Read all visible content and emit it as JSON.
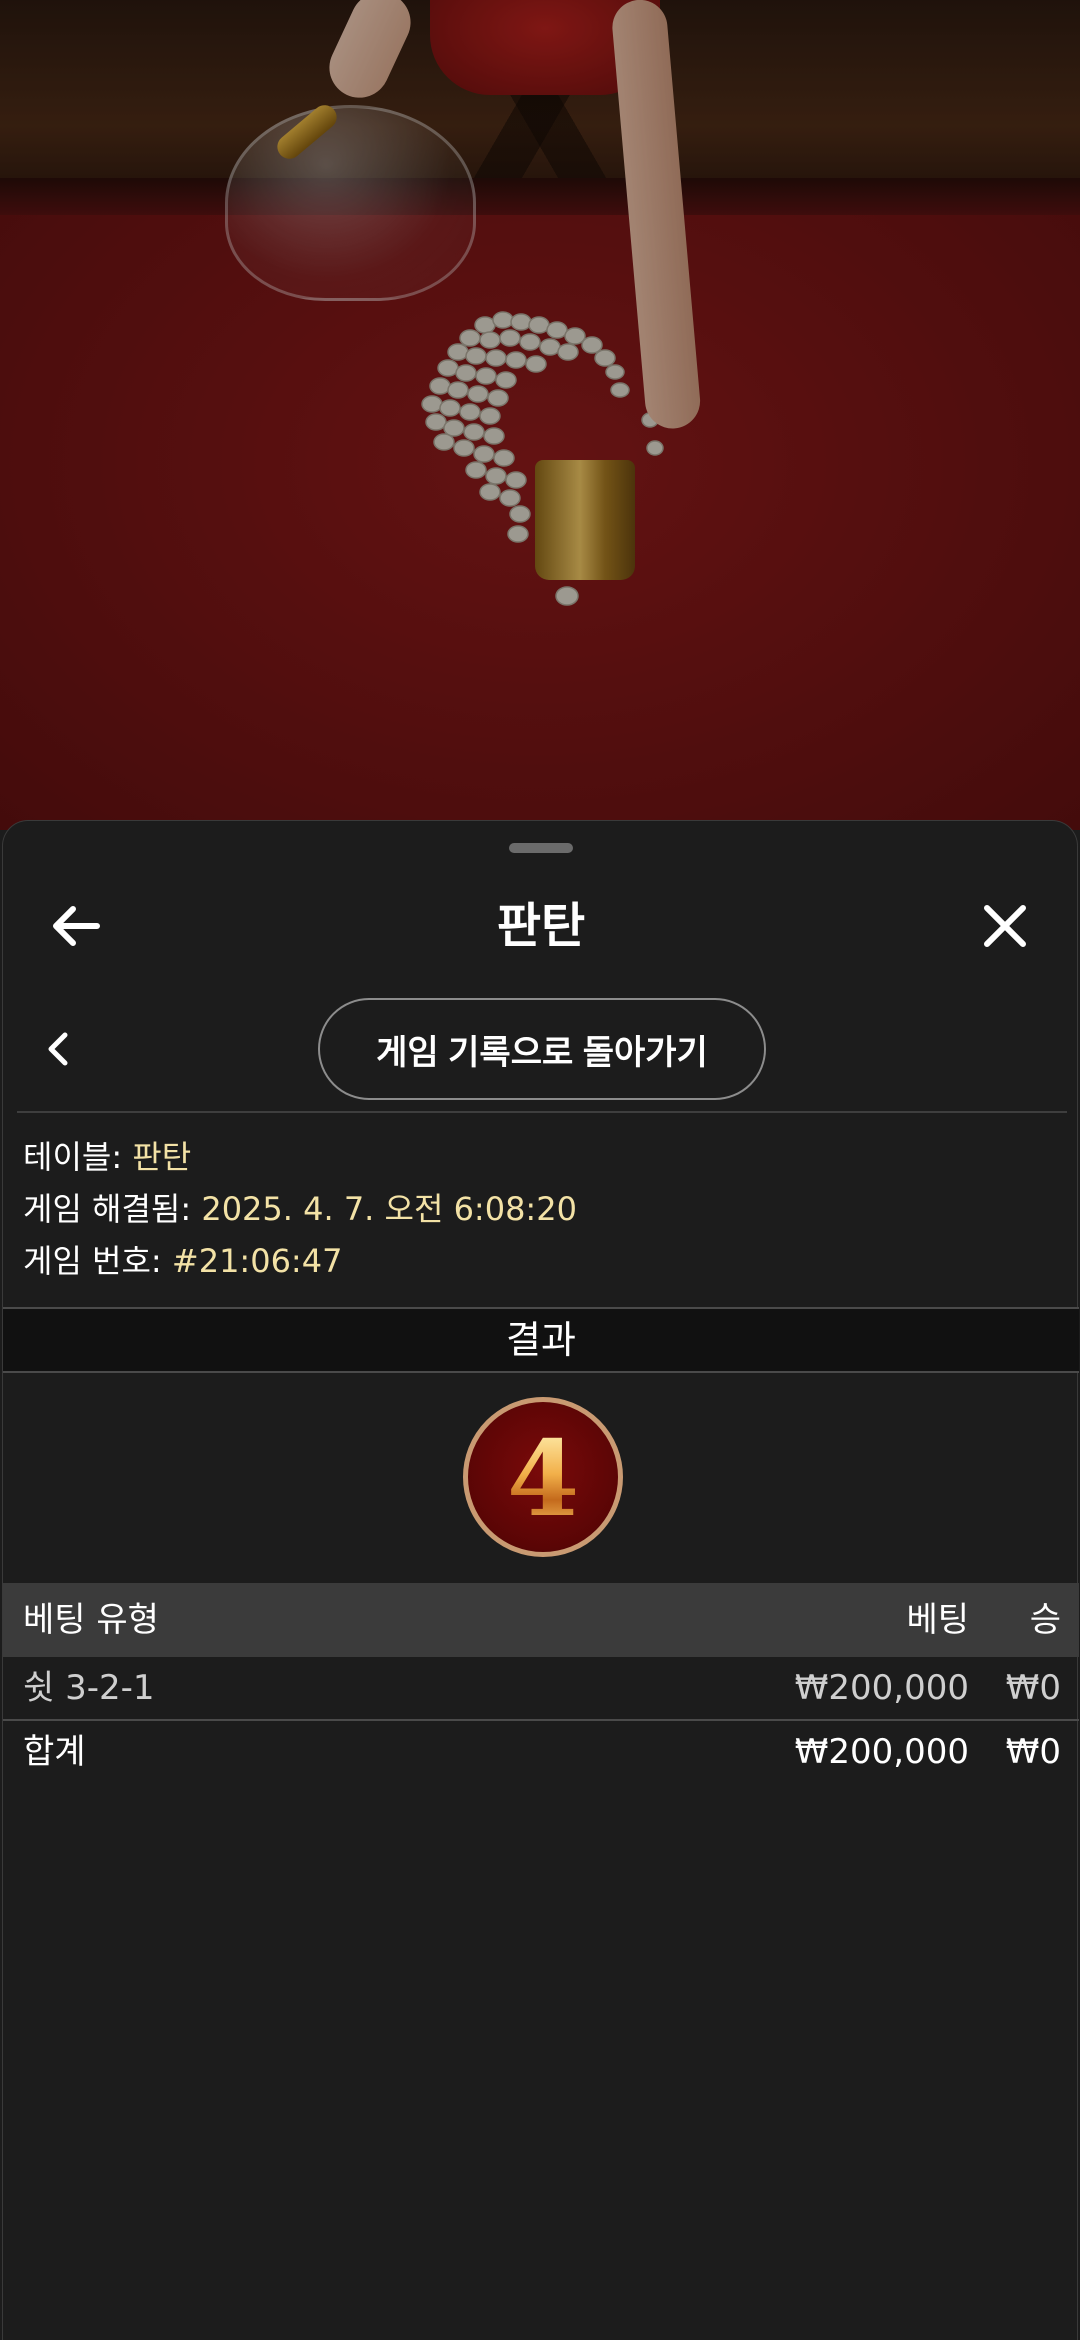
{
  "header": {
    "title": "판탄"
  },
  "subnav": {
    "history_button": "게임 기록으로 돌아가기"
  },
  "info": {
    "table_label": "테이블: ",
    "table_value": "판탄",
    "resolved_label": "게임 해결됨: ",
    "resolved_value": "2025. 4. 7. 오전 6:08:20",
    "game_number_label": "게임 번호: ",
    "game_number_value": "#21:06:47"
  },
  "result": {
    "heading": "결과",
    "number": "4"
  },
  "bets_table": {
    "columns": {
      "type": "베팅 유형",
      "bet": "베팅",
      "win": "승"
    },
    "rows": [
      {
        "type": "쉿 3-2-1",
        "bet": "₩200,000",
        "win": "₩0"
      }
    ],
    "total": {
      "type": "합계",
      "bet": "₩200,000",
      "win": "₩0"
    }
  },
  "icons": {
    "back": "arrow-left-icon",
    "close": "close-icon",
    "prev": "chevron-left-icon"
  },
  "colors": {
    "sheet_bg": "#1c1c1c",
    "info_value": "#f3e2a6",
    "result_badge": "#6a0808",
    "result_ring": "#c99a72"
  }
}
